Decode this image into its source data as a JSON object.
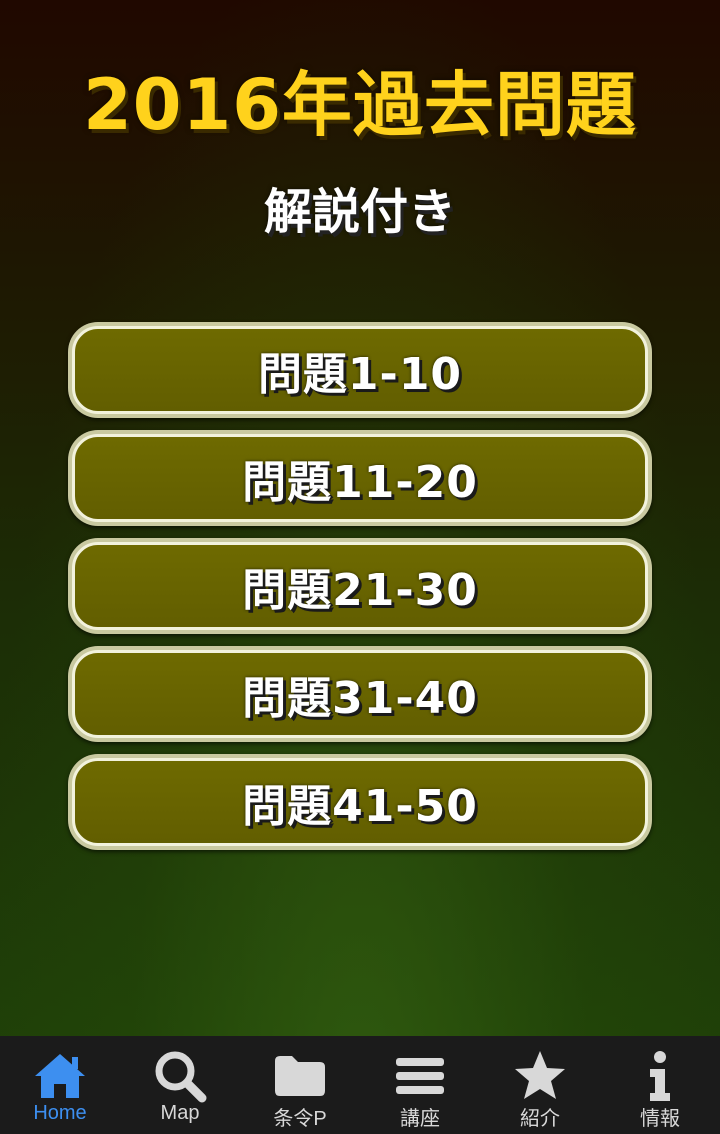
{
  "header": {
    "title": "2016年過去問題",
    "subtitle": "解説付き"
  },
  "questions": [
    {
      "label": "問題1-10"
    },
    {
      "label": "問題11-20"
    },
    {
      "label": "問題21-30"
    },
    {
      "label": "問題31-40"
    },
    {
      "label": "問題41-50"
    }
  ],
  "tabs": [
    {
      "label": "Home",
      "icon": "home-icon",
      "active": true
    },
    {
      "label": "Map",
      "icon": "search-icon",
      "active": false
    },
    {
      "label": "条令P",
      "icon": "folder-icon",
      "active": false
    },
    {
      "label": "講座",
      "icon": "menu-icon",
      "active": false
    },
    {
      "label": "紹介",
      "icon": "star-icon",
      "active": false
    },
    {
      "label": "情報",
      "icon": "info-icon",
      "active": false
    }
  ],
  "colors": {
    "title": "#ffd21c",
    "button_fill": "#656100",
    "tab_active": "#3d8ff0",
    "tab_inactive": "#d8d8d8",
    "tab_bar": "#1b1b1b"
  }
}
